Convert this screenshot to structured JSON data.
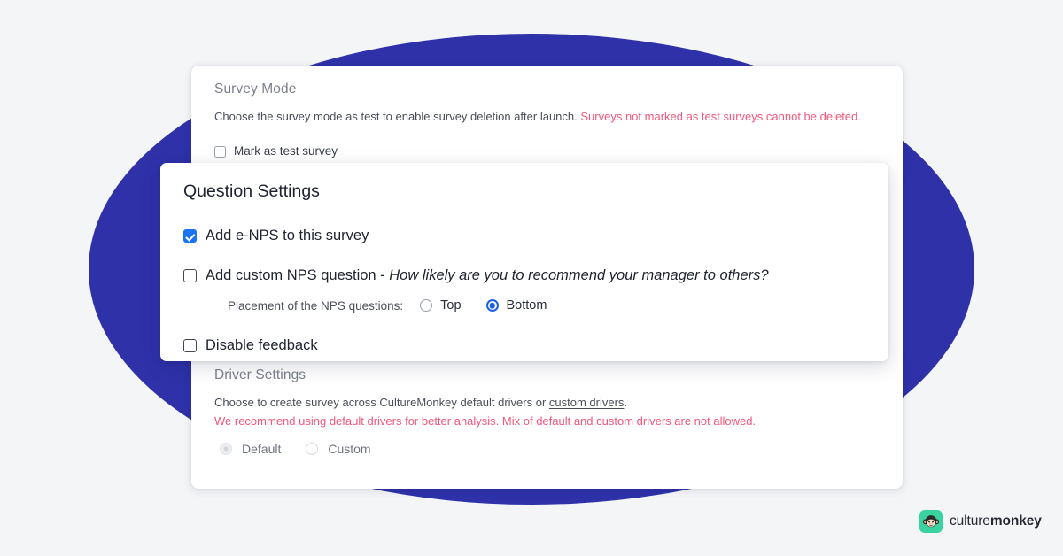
{
  "brand": {
    "logo_text_light": "culture",
    "logo_text_bold": "monkey",
    "logo_icon": "monkey-face-icon",
    "accent_green": "#3AD29F",
    "accent_blue": "#2E31A8",
    "checkbox_blue": "#1A73F0",
    "warning_pink": "#F2587C"
  },
  "survey_mode": {
    "title": "Survey Mode",
    "description": "Choose the survey mode as test to enable survey deletion after launch.",
    "warning": "Surveys not marked as test surveys cannot be deleted.",
    "checkbox": {
      "label": "Mark as test survey",
      "checked": false
    }
  },
  "question_settings": {
    "title": "Question Settings",
    "enps": {
      "label": "Add e-NPS to this survey",
      "checked": true
    },
    "custom_nps": {
      "label_prefix": "Add custom NPS question - ",
      "question_text": "How likely are you to recommend your manager to others?",
      "checked": false
    },
    "placement": {
      "label": "Placement of the NPS questions:",
      "options": [
        {
          "label": "Top",
          "selected": false
        },
        {
          "label": "Bottom",
          "selected": true
        }
      ]
    },
    "disable_feedback": {
      "label": "Disable feedback",
      "checked": false
    }
  },
  "driver_settings": {
    "title": "Driver Settings",
    "description_prefix": "Choose to create survey across CultureMonkey default drivers or ",
    "description_link": "custom drivers",
    "description_suffix": ".",
    "warning": "We recommend using default drivers for better analysis. Mix of default and custom drivers are not allowed.",
    "options": [
      {
        "label": "Default",
        "selected": true
      },
      {
        "label": "Custom",
        "selected": false
      }
    ]
  }
}
